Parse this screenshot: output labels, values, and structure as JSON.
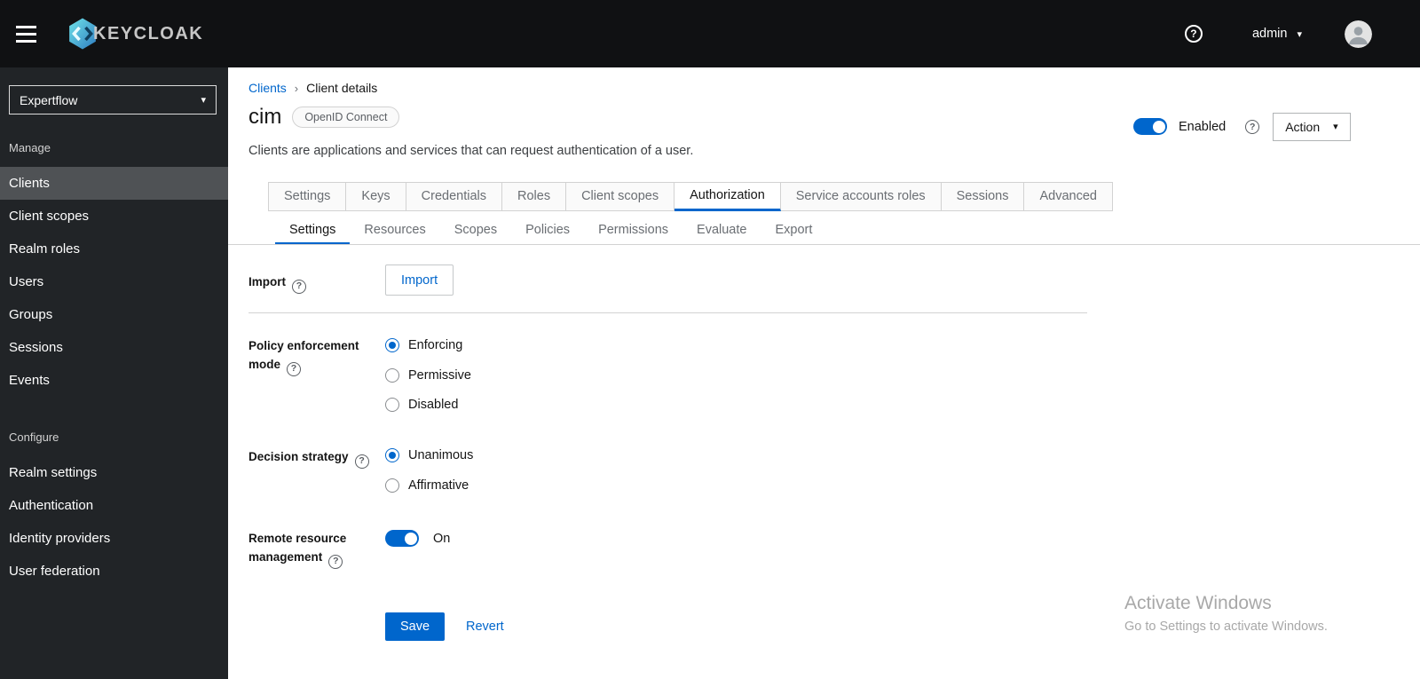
{
  "masthead": {
    "brand": "KEYCLOAK",
    "user": "admin"
  },
  "sidebar": {
    "realm": "Expertflow",
    "sections": [
      {
        "title": "Manage",
        "items": [
          "Clients",
          "Client scopes",
          "Realm roles",
          "Users",
          "Groups",
          "Sessions",
          "Events"
        ]
      },
      {
        "title": "Configure",
        "items": [
          "Realm settings",
          "Authentication",
          "Identity providers",
          "User federation"
        ]
      }
    ],
    "active_item": "Clients"
  },
  "breadcrumb": {
    "link": "Clients",
    "separator": "›",
    "current": "Client details"
  },
  "page": {
    "title": "cim",
    "badge": "OpenID Connect",
    "description": "Clients are applications and services that can request authentication of a user.",
    "enabled_toggle_label": "Enabled",
    "enabled_toggle_state": "on",
    "action_button": "Action"
  },
  "tabs": [
    "Settings",
    "Keys",
    "Credentials",
    "Roles",
    "Client scopes",
    "Authorization",
    "Service accounts roles",
    "Sessions",
    "Advanced"
  ],
  "active_tab": "Authorization",
  "subtabs": [
    "Settings",
    "Resources",
    "Scopes",
    "Policies",
    "Permissions",
    "Evaluate",
    "Export"
  ],
  "active_subtab": "Settings",
  "form": {
    "import_label": "Import",
    "import_button": "Import",
    "policy_label": "Policy enforcement mode",
    "policy_options": [
      "Enforcing",
      "Permissive",
      "Disabled"
    ],
    "policy_selected": "Enforcing",
    "decision_label": "Decision strategy",
    "decision_options": [
      "Unanimous",
      "Affirmative"
    ],
    "decision_selected": "Unanimous",
    "remote_label": "Remote resource management",
    "remote_state": "On",
    "save_button": "Save",
    "revert_link": "Revert"
  },
  "watermark": {
    "line1": "Activate Windows",
    "line2": "Go to Settings to activate Windows."
  },
  "icons": {
    "help": "?",
    "caret": "▾"
  },
  "colors": {
    "accent": "#0066cc",
    "masthead_bg": "#101113",
    "sidebar_bg": "#212427",
    "sidebar_active_bg": "#4f5255"
  }
}
